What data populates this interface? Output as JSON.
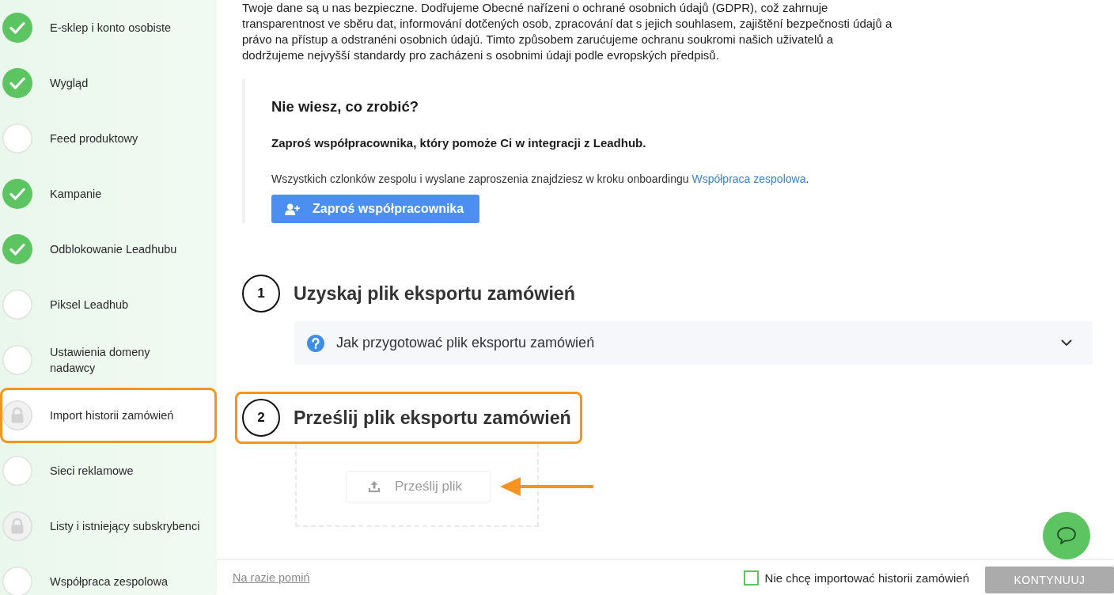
{
  "sidebar": {
    "items": [
      {
        "label": "E-sklep i konto osobiste",
        "done": true,
        "locked": false,
        "selected": false
      },
      {
        "label": "Wygląd",
        "done": true,
        "locked": false,
        "selected": false
      },
      {
        "label": "Feed produktowy",
        "done": false,
        "locked": false,
        "selected": false
      },
      {
        "label": "Kampanie",
        "done": true,
        "locked": false,
        "selected": false
      },
      {
        "label": "Odblokowanie Leadhubu",
        "done": true,
        "locked": false,
        "selected": false
      },
      {
        "label": "Piksel Leadhub",
        "done": false,
        "locked": false,
        "selected": false
      },
      {
        "label": "Ustawienia domeny\nnadawcy",
        "done": false,
        "locked": false,
        "selected": false
      },
      {
        "label": "Import historii zamówień",
        "done": false,
        "locked": true,
        "selected": true
      },
      {
        "label": "Sieci reklamowe",
        "done": false,
        "locked": false,
        "selected": false
      },
      {
        "label": "Listy i istniejący subskrybenci",
        "done": false,
        "locked": true,
        "selected": false
      },
      {
        "label": "Współpraca zespolowa",
        "done": false,
        "locked": false,
        "selected": false
      }
    ]
  },
  "main": {
    "privacy_text": "Twoje dane są u nas bezpieczne. Dodřujeme Obecné nařízeni o ochrané osobnich údajů (GDPR), což zahrnuje transparentnost ve sběru dat, informování dotčených osob, zpracování dat s jejich souhlasem, zajištění bezpečnosti údajů a právo na přístup a odstranéni osobnich údajú. Timto způsobem zarućujeme ochranu soukromi našich uživatelů a dodržujeme nejvyšší standardy pro zacházeni s osobnimi údaji podle evropských předpisů.",
    "help": {
      "title": "Nie wiesz, co zrobić?",
      "subtitle": "Zaproś współpracownika, który pomoże Ci w integracji z Leadhub.",
      "description": "Wszystkich czlonków zespolu i wyslane zaproszenia znajdziesz w kroku onboardingu",
      "link": "Współpraca zespolowa",
      "description_end": ".",
      "button": "Zaproś współpracownika"
    },
    "steps": [
      {
        "number": "1",
        "title": "Uzyskaj plik eksportu zamówień",
        "highlighted": false,
        "kind": "accordion",
        "accordion": {
          "label": "Jak przygotować plik eksportu zamówień",
          "expanded": false
        }
      },
      {
        "number": "2",
        "title": "Prześlij plik eksportu zamówień",
        "highlighted": true,
        "kind": "upload",
        "upload": {
          "button": "Prześlij plik",
          "disabled": true,
          "pointer_arrow": true
        }
      }
    ]
  },
  "footer": {
    "skip_link": "Na razie pomiń",
    "checkbox": {
      "label": "Nie chcę importować historii zamówień",
      "checked": false
    },
    "continue_button": {
      "label": "KONTYNUUJ",
      "disabled": true
    }
  }
}
